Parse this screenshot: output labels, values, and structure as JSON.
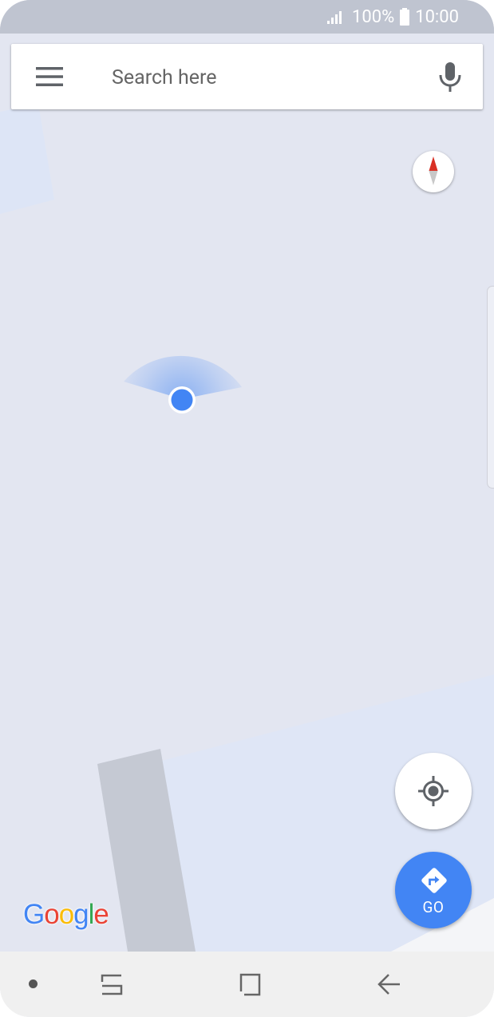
{
  "status_bar": {
    "battery": "100%",
    "time": "10:00",
    "icons": [
      "signal-icon",
      "battery-icon"
    ]
  },
  "search": {
    "placeholder": "Search here",
    "value": "",
    "icons": [
      "menu-icon",
      "mic-icon"
    ]
  },
  "map": {
    "compass_icon": "compass-icon",
    "location_icon": "my-location-icon",
    "colors": {
      "land": "#e3e6f1",
      "water": "#dde5f5",
      "road": "#c4c8d2",
      "location_dot": "#4285f4"
    }
  },
  "go_button": {
    "label": "GO",
    "icon": "directions-icon",
    "color": "#4285f4"
  },
  "google_logo": {
    "letters": [
      "G",
      "o",
      "o",
      "g",
      "l",
      "e"
    ],
    "colors": [
      "#4285f4",
      "#ea4335",
      "#fbbc05",
      "#4285f4",
      "#34a853",
      "#ea4335"
    ]
  },
  "nav_bar": {
    "icons": [
      "nav-dot-icon",
      "recents-icon",
      "home-icon",
      "back-icon"
    ]
  }
}
